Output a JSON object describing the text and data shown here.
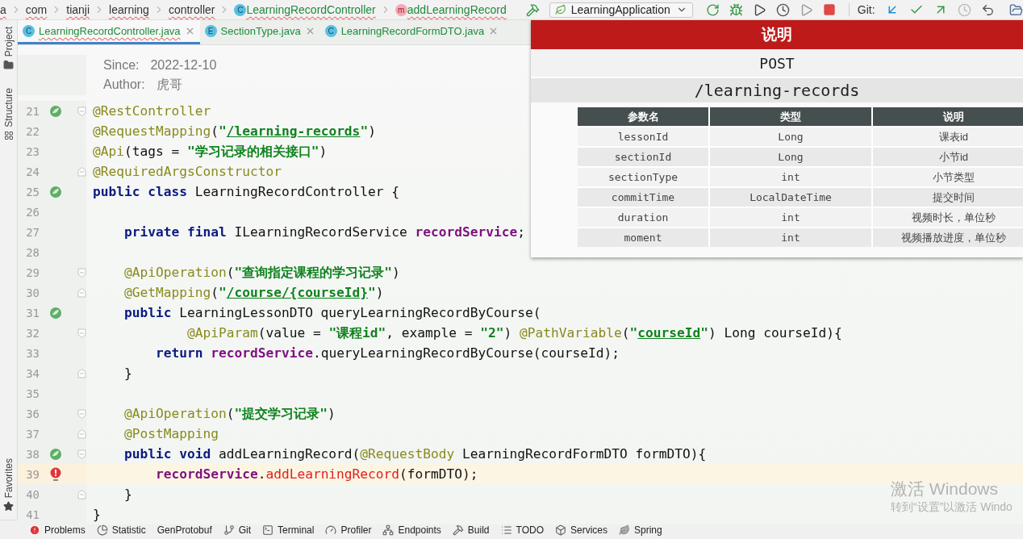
{
  "breadcrumb": [
    {
      "kind": "package",
      "label": "a"
    },
    {
      "kind": "package",
      "label": "com"
    },
    {
      "kind": "package",
      "label": "tianji"
    },
    {
      "kind": "package",
      "label": "learning"
    },
    {
      "kind": "package",
      "label": "controller"
    },
    {
      "kind": "class",
      "badge": "C",
      "label": "LearningRecordController"
    },
    {
      "kind": "method",
      "badge": "m",
      "label": "addLearningRecord"
    }
  ],
  "run_config": "LearningApplication",
  "git_label": "Git:",
  "side_tools": {
    "top": [
      "Project",
      "Structure"
    ],
    "bottom": [
      "Favorites"
    ]
  },
  "tabs": [
    {
      "badge": "C",
      "label": "LearningRecordController.java",
      "selected": true
    },
    {
      "badge": "E",
      "label": "SectionType.java",
      "selected": false
    },
    {
      "badge": "C",
      "label": "LearningRecordFormDTO.java",
      "selected": false
    }
  ],
  "doc": [
    {
      "label": "Since:",
      "value": "2022-12-10"
    },
    {
      "label": "Author:",
      "value": "虎哥"
    }
  ],
  "code_lines": [
    {
      "number": "21",
      "gutter_icon": {
        "kind": "bean"
      },
      "fold": {
        "kind": "open"
      },
      "current": false,
      "tokens": [
        {
          "kind": "annotation",
          "text": "@RestController"
        }
      ]
    },
    {
      "number": "22",
      "current": false,
      "tokens": [
        {
          "kind": "annotation",
          "text": "@RequestMapping"
        },
        {
          "kind": "plain",
          "text": "("
        },
        {
          "kind": "string",
          "text": "\""
        },
        {
          "kind": "link",
          "text": "/learning-records"
        },
        {
          "kind": "string",
          "text": "\""
        },
        {
          "kind": "plain",
          "text": ")"
        }
      ]
    },
    {
      "number": "23",
      "current": false,
      "tokens": [
        {
          "kind": "annotation",
          "text": "@Api"
        },
        {
          "kind": "plain",
          "text": "(tags = "
        },
        {
          "kind": "string",
          "text": "\"学习记录的相关接口\""
        },
        {
          "kind": "plain",
          "text": ")"
        }
      ]
    },
    {
      "number": "24",
      "fold": {
        "kind": "close"
      },
      "current": false,
      "tokens": [
        {
          "kind": "annotation",
          "text": "@RequiredArgsConstructor"
        }
      ]
    },
    {
      "number": "25",
      "gutter_icon": {
        "kind": "bean"
      },
      "current": false,
      "tokens": [
        {
          "kind": "keyword",
          "text": "public class"
        },
        {
          "kind": "plain",
          "text": " LearningRecordController {"
        }
      ]
    },
    {
      "number": "26",
      "current": false
    },
    {
      "number": "27",
      "current": false,
      "tokens": [
        {
          "kind": "keyword",
          "text": "    private final"
        },
        {
          "kind": "plain",
          "text": " ILearningRecordService "
        },
        {
          "kind": "field",
          "text": "recordService"
        },
        {
          "kind": "plain",
          "text": ";"
        }
      ]
    },
    {
      "number": "28",
      "current": false
    },
    {
      "number": "29",
      "fold": {
        "kind": "open"
      },
      "current": false,
      "tokens": [
        {
          "kind": "annotation",
          "text": "    @ApiOperation"
        },
        {
          "kind": "plain",
          "text": "("
        },
        {
          "kind": "string",
          "text": "\"查询指定课程的学习记录\""
        },
        {
          "kind": "plain",
          "text": ")"
        }
      ]
    },
    {
      "number": "30",
      "fold": {
        "kind": "close"
      },
      "current": false,
      "tokens": [
        {
          "kind": "annotation",
          "text": "    @GetMapping"
        },
        {
          "kind": "plain",
          "text": "("
        },
        {
          "kind": "string",
          "text": "\""
        },
        {
          "kind": "link",
          "text": "/course/{courseId}"
        },
        {
          "kind": "string",
          "text": "\""
        },
        {
          "kind": "plain",
          "text": ")"
        }
      ]
    },
    {
      "number": "31",
      "gutter_icon": {
        "kind": "bean"
      },
      "current": false,
      "tokens": [
        {
          "kind": "keyword",
          "text": "    public"
        },
        {
          "kind": "plain",
          "text": " LearningLessonDTO queryLearningRecordByCourse("
        }
      ]
    },
    {
      "number": "32",
      "fold": {
        "kind": "open"
      },
      "current": false,
      "tokens": [
        {
          "kind": "annotation",
          "text": "            @ApiParam"
        },
        {
          "kind": "plain",
          "text": "(value = "
        },
        {
          "kind": "string",
          "text": "\"课程id\""
        },
        {
          "kind": "plain",
          "text": ", example = "
        },
        {
          "kind": "string",
          "text": "\"2\""
        },
        {
          "kind": "plain",
          "text": ") "
        },
        {
          "kind": "annotation",
          "text": "@PathVariable"
        },
        {
          "kind": "plain",
          "text": "("
        },
        {
          "kind": "string",
          "text": "\""
        },
        {
          "kind": "link",
          "text": "courseId"
        },
        {
          "kind": "string",
          "text": "\""
        },
        {
          "kind": "plain",
          "text": ") Long courseId){"
        }
      ]
    },
    {
      "number": "33",
      "current": false,
      "tokens": [
        {
          "kind": "keyword",
          "text": "        return"
        },
        {
          "kind": "field",
          "text": " recordService"
        },
        {
          "kind": "plain",
          "text": ".queryLearningRecordByCourse(courseId);"
        }
      ]
    },
    {
      "number": "34",
      "fold": {
        "kind": "close"
      },
      "current": false,
      "tokens": [
        {
          "kind": "plain",
          "text": "    }"
        }
      ]
    },
    {
      "number": "35",
      "current": false
    },
    {
      "number": "36",
      "fold": {
        "kind": "open"
      },
      "current": false,
      "tokens": [
        {
          "kind": "annotation",
          "text": "    @ApiOperation"
        },
        {
          "kind": "plain",
          "text": "("
        },
        {
          "kind": "string",
          "text": "\"提交学习记录\""
        },
        {
          "kind": "plain",
          "text": ")"
        }
      ]
    },
    {
      "number": "37",
      "fold": {
        "kind": "close"
      },
      "current": false,
      "tokens": [
        {
          "kind": "annotation",
          "text": "    @PostMapping"
        }
      ]
    },
    {
      "number": "38",
      "gutter_icon": {
        "kind": "bean"
      },
      "fold": {
        "kind": "open"
      },
      "current": false,
      "tokens": [
        {
          "kind": "keyword",
          "text": "    public void"
        },
        {
          "kind": "plain",
          "text": " addLearningRecord("
        },
        {
          "kind": "annotation",
          "text": "@RequestBody"
        },
        {
          "kind": "plain",
          "text": " LearningRecordFormDTO formDTO){"
        }
      ]
    },
    {
      "number": "39",
      "gutter_icon": {
        "kind": "error"
      },
      "current": true,
      "tokens": [
        {
          "kind": "field",
          "text": "        recordService"
        },
        {
          "kind": "plain",
          "text": "."
        },
        {
          "kind": "error",
          "text": "addLearningRecord"
        },
        {
          "kind": "plain",
          "text": "(formDTO);"
        }
      ]
    },
    {
      "number": "40",
      "fold": {
        "kind": "close"
      },
      "current": false,
      "tokens": [
        {
          "kind": "plain",
          "text": "    }"
        }
      ]
    },
    {
      "number": "41",
      "current": false,
      "tokens": [
        {
          "kind": "plain",
          "text": "}"
        }
      ]
    }
  ],
  "api_panel": {
    "title": "说明",
    "method": "POST",
    "path": "/learning-records",
    "columns": [
      "参数名",
      "类型",
      "说明"
    ],
    "rows": [
      {
        "name": "lessonId",
        "type": "Long",
        "description": "课表id"
      },
      {
        "name": "sectionId",
        "type": "Long",
        "description": "小节id"
      },
      {
        "name": "sectionType",
        "type": "int",
        "description": "小节类型"
      },
      {
        "name": "commitTime",
        "type": "LocalDateTime",
        "description": "提交时间"
      },
      {
        "name": "duration",
        "type": "int",
        "description": "视频时长，单位秒"
      },
      {
        "name": "moment",
        "type": "int",
        "description": "视频播放进度，单位秒"
      }
    ]
  },
  "activation_notice": {
    "title": "激活 Windows",
    "hint": "转到“设置”以激活 Windo"
  },
  "bottom_tools": [
    {
      "kind": "problems",
      "label": "Problems"
    },
    {
      "kind": "statistic",
      "label": "Statistic"
    },
    {
      "kind": "plain",
      "label": "GenProtobuf"
    },
    {
      "kind": "git",
      "label": "Git"
    },
    {
      "kind": "terminal",
      "label": "Terminal"
    },
    {
      "kind": "profiler",
      "label": "Profiler"
    },
    {
      "kind": "endpoints",
      "label": "Endpoints"
    },
    {
      "kind": "build",
      "label": "Build"
    },
    {
      "kind": "todo",
      "label": "TODO"
    },
    {
      "kind": "services",
      "label": "Services"
    },
    {
      "kind": "spring",
      "label": "Spring"
    }
  ]
}
